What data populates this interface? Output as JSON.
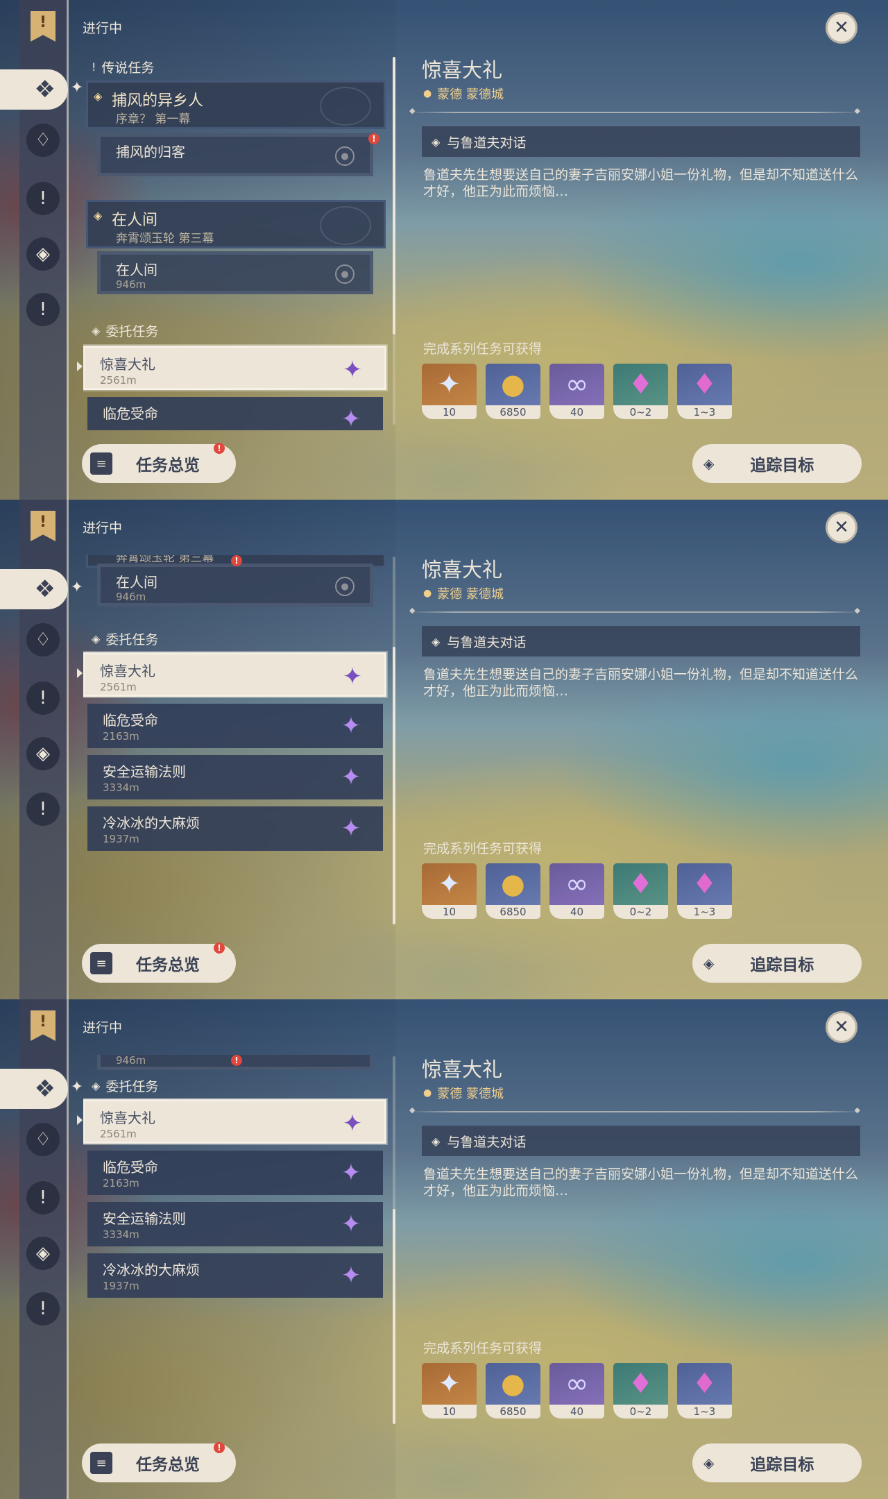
{
  "header": {
    "label": "进行中"
  },
  "nav": {
    "top_icon": "quest-book-icon",
    "items": [
      "archon-quest-icon",
      "story-quest-icon",
      "world-quest-icon",
      "event-quest-icon",
      "exclamation-quest-icon"
    ]
  },
  "list": {
    "legend_category": "传说任务",
    "commission_category": "委托任务",
    "groups": [
      {
        "title": "捕风的异乡人",
        "subtitle": "序章？ 第一幕",
        "sub_title": "捕风的归客",
        "sub_dist": ""
      },
      {
        "title": "在人间",
        "subtitle": "奔霄颂玉轮 第三幕",
        "sub_title": "在人间",
        "sub_dist": "946m"
      }
    ],
    "commissions": [
      {
        "title": "惊喜大礼",
        "distance": "2561m"
      },
      {
        "title": "临危受命",
        "distance": "2163m"
      },
      {
        "title": "安全运输法则",
        "distance": "3334m"
      },
      {
        "title": "冷冰冰的大麻烦",
        "distance": "1937m"
      }
    ]
  },
  "detail": {
    "title": "惊喜大礼",
    "location": "蒙德 蒙德城",
    "step": "与鲁道夫对话",
    "description": "鲁道夫先生想要送自己的妻子吉丽安娜小姐一份礼物，但是却不知道送什么才好，他正为此而烦恼…",
    "rewards_label": "完成系列任务可获得",
    "rewards": [
      {
        "icon": "primogem-icon",
        "count": "10"
      },
      {
        "icon": "mora-icon",
        "count": "6850"
      },
      {
        "icon": "friendship-exp-icon",
        "count": "40"
      },
      {
        "icon": "crystal-chunk-icon",
        "count": "0~2"
      },
      {
        "icon": "enhancement-ore-icon",
        "count": "1~3"
      }
    ]
  },
  "buttons": {
    "overview": "任务总览",
    "track": "追踪目标"
  },
  "colors": {
    "panel_cream": "#ece5d8",
    "location_gold": "#f0cf8c",
    "badge_red": "#e0473d",
    "commission_purple": "#b68cf0"
  }
}
